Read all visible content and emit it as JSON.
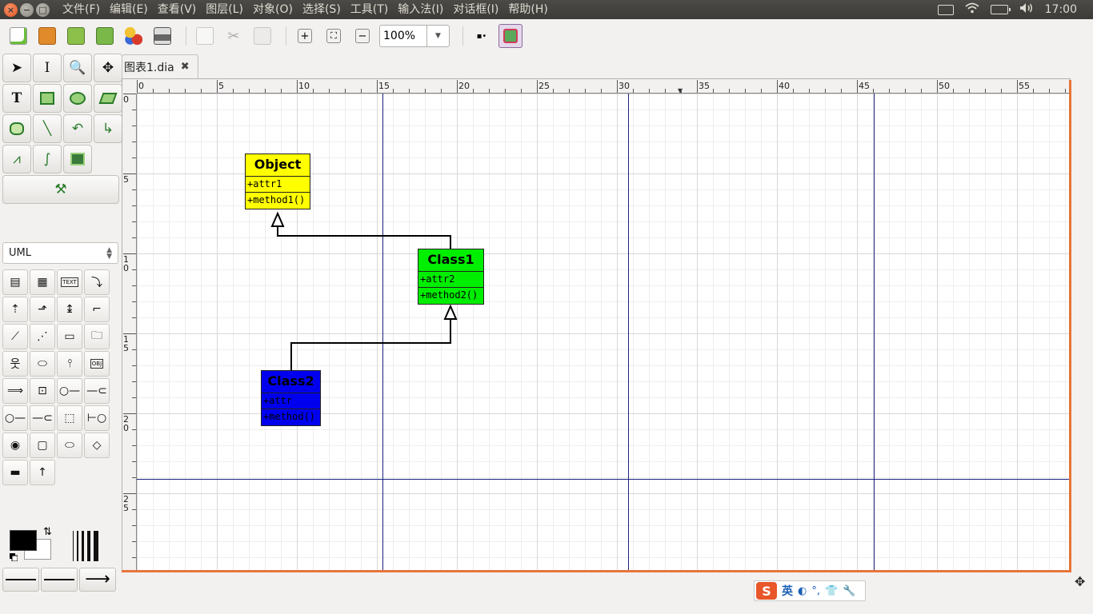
{
  "menubar": {
    "items": [
      "文件(F)",
      "编辑(E)",
      "查看(V)",
      "图层(L)",
      "对象(O)",
      "选择(S)",
      "工具(T)",
      "输入法(I)",
      "对话框(I)",
      "帮助(H)"
    ],
    "clock": "17:00"
  },
  "toolbar": {
    "zoom_value": "100%"
  },
  "toolbox": {
    "sheet_name": "UML"
  },
  "tab": {
    "title": "图表1.dia"
  },
  "rulers": {
    "horizontal_labels": [
      "0",
      "5",
      "10",
      "15",
      "20",
      "25",
      "30",
      "35",
      "40",
      "45",
      "50",
      "55"
    ],
    "vertical_labels": [
      "0",
      "5",
      "10",
      "15",
      "20",
      "25"
    ]
  },
  "diagram": {
    "classes": [
      {
        "name": "Object",
        "attribute": "+attr1",
        "operation": "+method1()",
        "color": "#ffff00"
      },
      {
        "name": "Class1",
        "attribute": "+attr2",
        "operation": "+method2()",
        "color": "#00ee00"
      },
      {
        "name": "Class2",
        "attribute": "+attr",
        "operation": "+method()",
        "color": "#0000ee"
      }
    ]
  },
  "ime": {
    "logo": "S",
    "mode": "英"
  },
  "colors": {
    "accent_orange": "#e8743b",
    "page_boundary": "#1a237e"
  }
}
